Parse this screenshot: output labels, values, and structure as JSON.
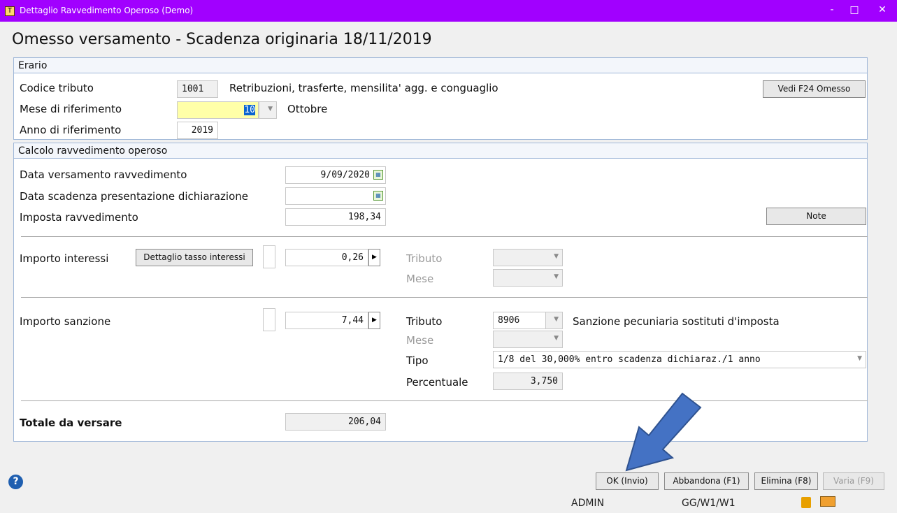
{
  "window": {
    "title": "Dettaglio Ravvedimento Operoso (Demo)",
    "app_icon": "T",
    "minimize": "-",
    "maximize": "□",
    "close": "✕"
  },
  "heading": "Omesso versamento - Scadenza originaria 18/11/2019",
  "erario": {
    "header": "Erario",
    "codice_tributo_label": "Codice tributo",
    "codice_tributo_value": "1001",
    "codice_tributo_desc": "Retribuzioni, trasferte, mensilita' agg. e conguaglio",
    "vedi_f24_button": "Vedi F24 Omesso",
    "mese_label": "Mese di riferimento",
    "mese_value": "10",
    "mese_desc": "Ottobre",
    "anno_label": "Anno di riferimento",
    "anno_value": "2019"
  },
  "calcolo": {
    "header": "Calcolo ravvedimento operoso",
    "data_versamento_label": "Data versamento ravvedimento",
    "data_versamento_value": "9/09/2020",
    "data_scadenza_label": "Data scadenza presentazione dichiarazione",
    "data_scadenza_value": "",
    "imposta_label": "Imposta ravvedimento",
    "imposta_value": "198,34",
    "note_button": "Note",
    "interessi": {
      "label": "Importo interessi",
      "dettaglio_button": "Dettaglio tasso interessi",
      "value": "0,26",
      "tributo_label": "Tributo",
      "mese_label": "Mese"
    },
    "sanzione": {
      "label": "Importo sanzione",
      "value": "7,44",
      "tributo_label": "Tributo",
      "tributo_value": "8906",
      "tributo_desc": "Sanzione pecuniaria sostituti d'imposta",
      "mese_label": "Mese",
      "tipo_label": "Tipo",
      "tipo_value": "1/8 del 30,000% entro scadenza dichiaraz./1 anno",
      "percentuale_label": "Percentuale",
      "percentuale_value": "3,750"
    },
    "totale_label": "Totale da versare",
    "totale_value": "206,04"
  },
  "buttons": {
    "ok": "OK (Invio)",
    "abbandona": "Abbandona (F1)",
    "elimina": "Elimina (F8)",
    "varia": "Varia (F9)"
  },
  "statusbar": {
    "user": "ADMIN",
    "path": "GG/W1/W1"
  },
  "colors": {
    "titlebar": "#a100ff",
    "arrow": "#4472c4",
    "highlight_field": "#ffffa8"
  }
}
